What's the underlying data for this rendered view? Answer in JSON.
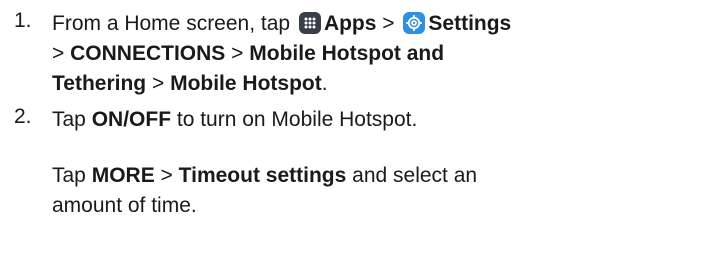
{
  "step1": {
    "number": "1.",
    "t1": "From a Home screen, tap",
    "apps_icon": "apps-grid-icon",
    "apps": "Apps",
    "gt1": ">",
    "settings_icon": "settings-gear-icon",
    "settings": "Settings",
    "gt2": ">",
    "connections": "CONNECTIONS",
    "gt3": ">",
    "hotspot_tethering": "Mobile Hotspot and Tethering",
    "gt4": ">",
    "mobile_hotspot": "Mobile Hotspot",
    "period": "."
  },
  "step2": {
    "number": "2.",
    "t1": "Tap",
    "onoff": "ON/OFF",
    "t2": "to turn on Mobile Hotspot."
  },
  "note": {
    "t1": "Tap",
    "more": "MORE",
    "gt": ">",
    "timeout": "Timeout settings",
    "t2": "and select an",
    "t3": "amount of time."
  },
  "colors": {
    "text": "#1a1a1a",
    "apps_icon_bg": "#3a3d4a",
    "settings_icon_bg": "#2f8fe0"
  }
}
